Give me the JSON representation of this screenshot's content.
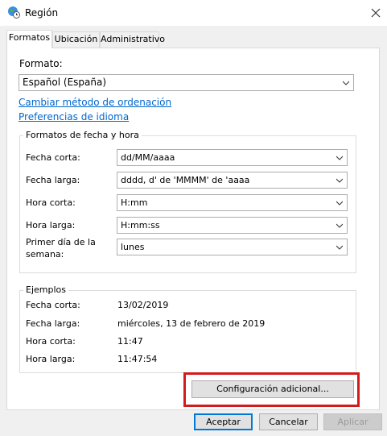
{
  "window": {
    "title": "Región"
  },
  "tabs": [
    {
      "label": "Formatos"
    },
    {
      "label": "Ubicación"
    },
    {
      "label": "Administrativo"
    }
  ],
  "format": {
    "label": "Formato:",
    "value": "Español (España)"
  },
  "links": {
    "sort": "Cambiar método de ordenación",
    "language": "Preferencias de idioma"
  },
  "datetime_group": {
    "title": "Formatos de fecha y hora",
    "rows": [
      {
        "label": "Fecha corta:",
        "value": "dd/MM/aaaa"
      },
      {
        "label": "Fecha larga:",
        "value": "dddd, d' de 'MMMM' de 'aaaa"
      },
      {
        "label": "Hora corta:",
        "value": "H:mm"
      },
      {
        "label": "Hora larga:",
        "value": "H:mm:ss"
      },
      {
        "label": "Primer día de la semana:",
        "value": "lunes"
      }
    ]
  },
  "examples_group": {
    "title": "Ejemplos",
    "rows": [
      {
        "label": "Fecha corta:",
        "value": "13/02/2019"
      },
      {
        "label": "Fecha larga:",
        "value": "miércoles, 13 de febrero de 2019"
      },
      {
        "label": "Hora corta:",
        "value": "11:47"
      },
      {
        "label": "Hora larga:",
        "value": "11:47:54"
      }
    ]
  },
  "buttons": {
    "additional": "Configuración adicional...",
    "ok": "Aceptar",
    "cancel": "Cancelar",
    "apply": "Aplicar"
  },
  "colors": {
    "link": "#0066cc",
    "highlight": "#d21b1b",
    "primary_border": "#0078d7"
  },
  "icons": {
    "app": "globe-clock-icon",
    "close": "close-icon",
    "dropdown": "chevron-down-icon"
  }
}
